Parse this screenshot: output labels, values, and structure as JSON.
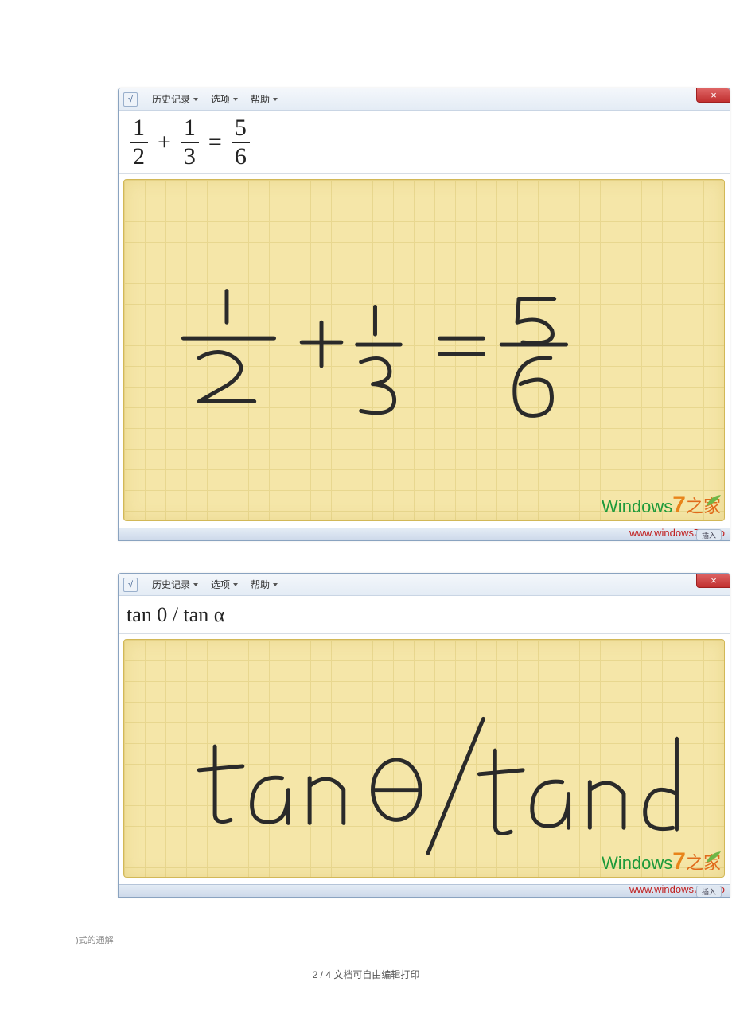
{
  "menubar": {
    "history": "历史记录",
    "options": "选项",
    "help": "帮助"
  },
  "panel1": {
    "equation": {
      "f1": {
        "num": "1",
        "den": "2"
      },
      "op1": "+",
      "f2": {
        "num": "1",
        "den": "3"
      },
      "op2": "=",
      "f3": {
        "num": "5",
        "den": "6"
      }
    },
    "ink_description": "1/2 + 1/3 = 5/6"
  },
  "panel2": {
    "result_text": "tan 0 / tan α",
    "ink_description": "tan Θ / tand"
  },
  "watermark": {
    "brand_a": "Windows",
    "brand_b": "7",
    "brand_c": "之家",
    "url": "www.windows7en.co"
  },
  "status": {
    "pill": "插入"
  },
  "orphan": ")式的通解",
  "footer": "2 / 4 文档可自由编辑打印"
}
